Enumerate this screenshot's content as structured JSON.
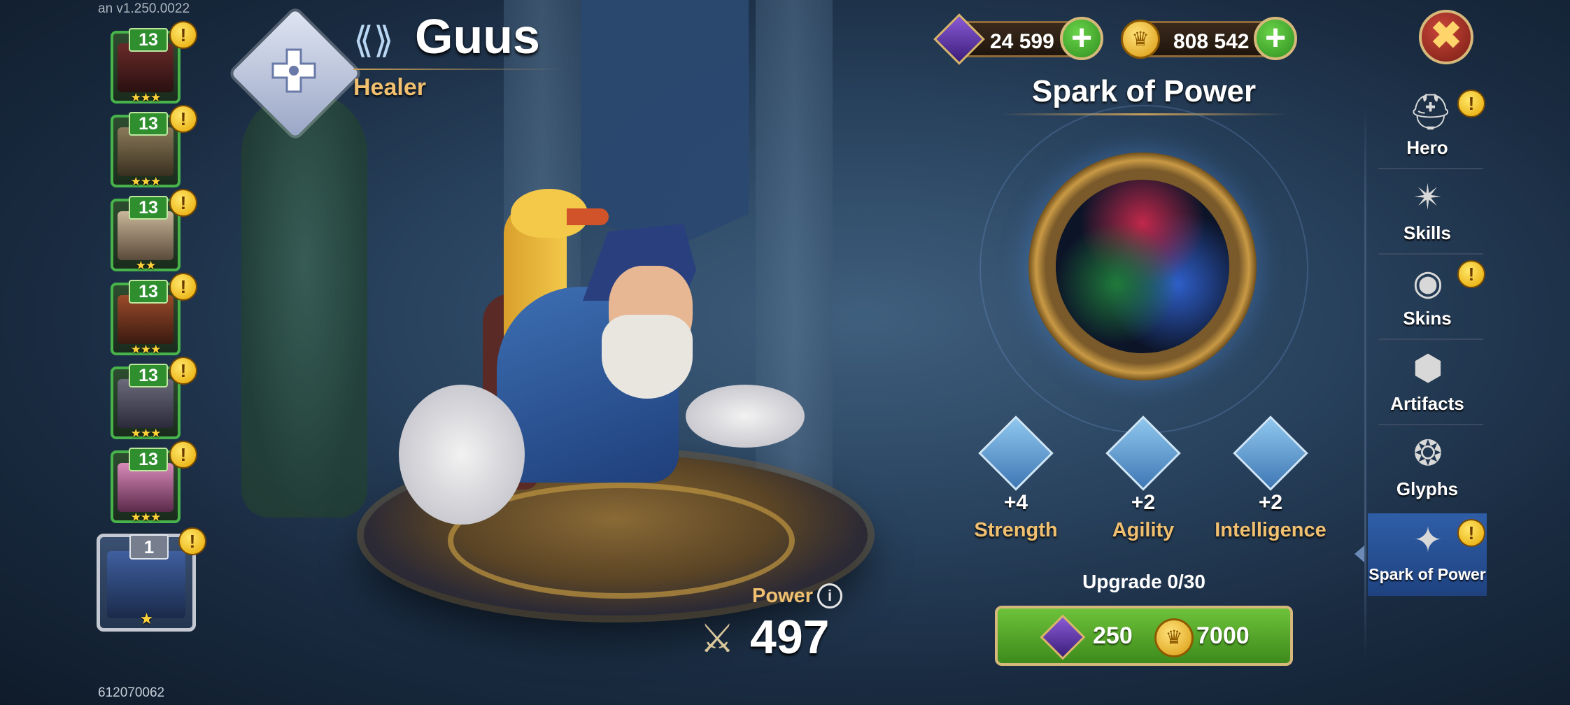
{
  "debug": {
    "version": "an v1.250.0022",
    "player_id": "612070062"
  },
  "hero": {
    "name": "Guus",
    "class": "Healer",
    "class_icon": "healer-cross-icon"
  },
  "currencies": {
    "emeralds": "24 599",
    "gold": "808 542",
    "add_symbol": "+"
  },
  "roster": [
    {
      "level": "13",
      "stars": "★★★",
      "alert": "!"
    },
    {
      "level": "13",
      "stars": "★★★",
      "alert": "!"
    },
    {
      "level": "13",
      "stars": "★★",
      "alert": "!"
    },
    {
      "level": "13",
      "stars": "★★★",
      "alert": "!"
    },
    {
      "level": "13",
      "stars": "★★★",
      "alert": "!"
    },
    {
      "level": "13",
      "stars": "★★★",
      "alert": "!"
    },
    {
      "level": "1",
      "stars": "★",
      "alert": "!",
      "selected": true
    }
  ],
  "power": {
    "label": "Power",
    "value": "497",
    "info": "i"
  },
  "spark": {
    "title": "Spark of Power",
    "stats": [
      {
        "name": "Strength",
        "value": "+4",
        "icon": "strength-fist-icon"
      },
      {
        "name": "Agility",
        "value": "+2",
        "icon": "agility-boot-icon"
      },
      {
        "name": "Intelligence",
        "value": "+2",
        "icon": "intelligence-hat-icon"
      }
    ],
    "upgrade_text": "Upgrade 0/30",
    "cost_emeralds": "250",
    "cost_gold": "7000"
  },
  "nav": [
    {
      "label": "Hero",
      "icon": "helmet-icon",
      "alert": "!"
    },
    {
      "label": "Skills",
      "icon": "skills-icon",
      "alert": ""
    },
    {
      "label": "Skins",
      "icon": "eye-icon",
      "alert": "!"
    },
    {
      "label": "Artifacts",
      "icon": "artifact-icon",
      "alert": ""
    },
    {
      "label": "Glyphs",
      "icon": "glyph-icon",
      "alert": ""
    },
    {
      "label": "Spark of Power",
      "icon": "spark-icon",
      "alert": "!",
      "active": true
    }
  ],
  "close_symbol": "✖",
  "colors": {
    "accent_gold": "#f0c070",
    "roster_green": "#47b34a",
    "button_green": "#3d8a1c"
  }
}
